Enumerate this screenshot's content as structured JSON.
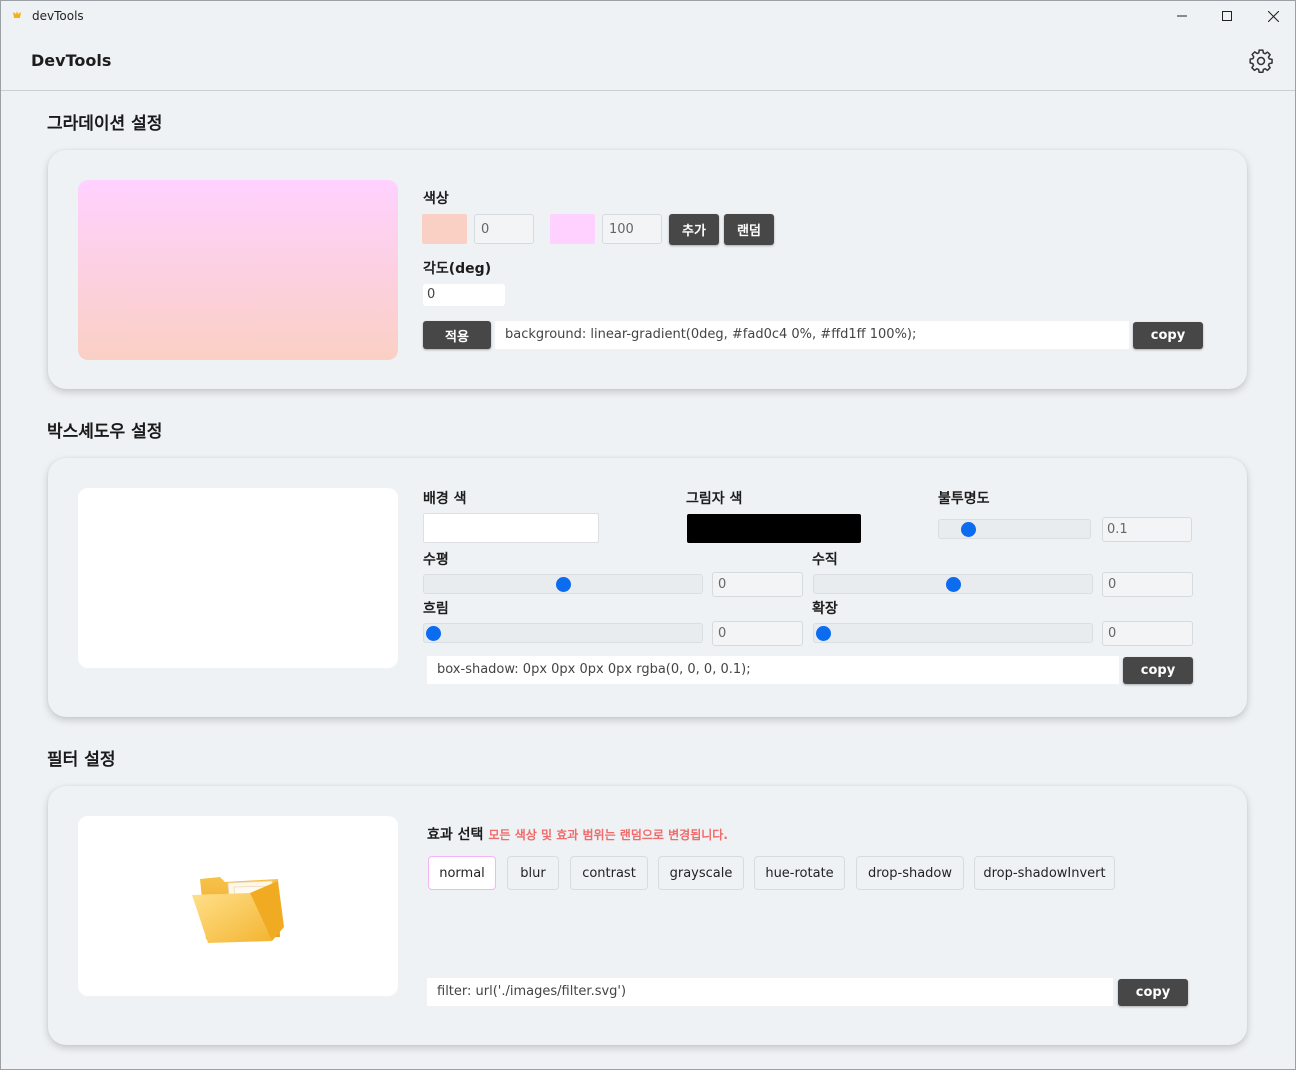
{
  "window": {
    "title": "devTools"
  },
  "header": {
    "app_name": "DevTools"
  },
  "gradient": {
    "section_title": "그라데이션 설정",
    "color_label": "색상",
    "color1": "#fad0c4",
    "stop1": "0",
    "color2": "#ffd1ff",
    "stop2": "100",
    "add_label": "추가",
    "random_label": "랜덤",
    "angle_label": "각도(deg)",
    "angle_value": "0",
    "apply_label": "적용",
    "css_output": "background: linear-gradient(0deg, #fad0c4 0%, #ffd1ff 100%);",
    "copy_label": "copy"
  },
  "boxshadow": {
    "section_title": "박스셰도우 설정",
    "bg_color_label": "배경 색",
    "bg_color": "#ffffff",
    "shadow_color_label": "그림자 색",
    "shadow_color": "#000000",
    "opacity_label": "불투명도",
    "opacity_value": "0.1",
    "opacity_fraction": 0.15,
    "horizontal_label": "수평",
    "horizontal_value": "0",
    "horizontal_fraction": 0.5,
    "vertical_label": "수직",
    "vertical_value": "0",
    "vertical_fraction": 0.5,
    "blur_label": "흐림",
    "blur_value": "0",
    "blur_fraction": 0.0,
    "spread_label": "확장",
    "spread_value": "0",
    "spread_fraction": 0.0,
    "css_output": "box-shadow: 0px 0px 0px 0px rgba(0, 0, 0, 0.1);",
    "copy_label": "copy"
  },
  "filter": {
    "section_title": "필터 설정",
    "effect_label": "효과 선택",
    "hint": "모든 색상 및 효과 범위는 랜덤으로 변경됩니다.",
    "effects": [
      "normal",
      "blur",
      "contrast",
      "grayscale",
      "hue-rotate",
      "drop-shadow",
      "drop-shadowInvert"
    ],
    "active_effect": "normal",
    "css_output": "filter: url('./images/filter.svg')",
    "copy_label": "copy",
    "preview_icon": "folder-icon"
  },
  "colors": {
    "accent": "#0b6cf0",
    "dark_button": "#474747",
    "hint_red": "#f06b6b"
  }
}
